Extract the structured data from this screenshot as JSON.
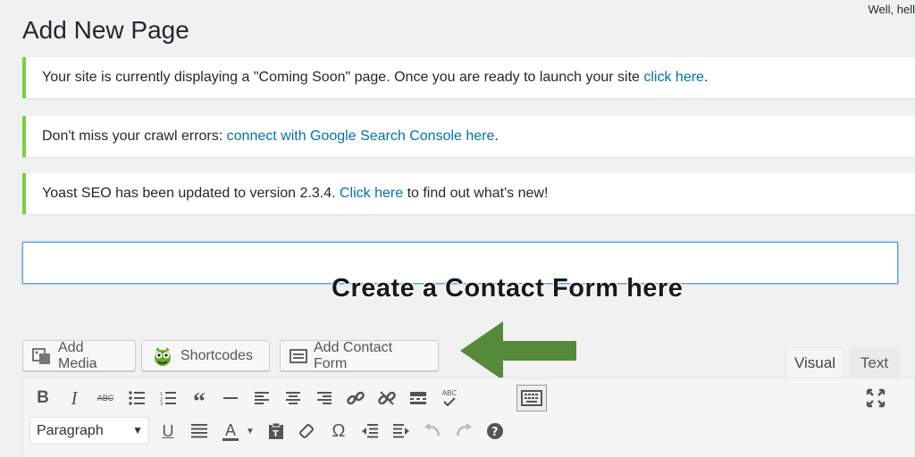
{
  "header": {
    "greeting": "Well, hell",
    "page_title": "Add New Page"
  },
  "notices": [
    {
      "before": "Your site is currently displaying a \"Coming Soon\" page. Once you are ready to launch your site ",
      "link": "click here",
      "after": "."
    },
    {
      "before": "Don't miss your crawl errors: ",
      "link": "connect with Google Search Console here",
      "after": "."
    },
    {
      "before": "Yoast SEO has been updated to version 2.3.4. ",
      "link": "Click here",
      "after": " to find out what's new!"
    }
  ],
  "title_input": {
    "value": "",
    "placeholder": ""
  },
  "annotation": {
    "text": "Create a Contact Form here",
    "arrow_color": "#548a3a"
  },
  "media_buttons": {
    "add_media": "Add Media",
    "shortcodes": "Shortcodes",
    "add_contact_form": "Add Contact Form"
  },
  "editor_tabs": {
    "visual": "Visual",
    "text": "Text"
  },
  "toolbar": {
    "bold": "B",
    "italic": "I",
    "strike": "ABC",
    "format_value": "Paragraph",
    "underline": "U",
    "text_color": "A",
    "omega": "Ω",
    "help": "?",
    "spellcheck": "ABC"
  },
  "colors": {
    "notice_border": "#7ad03a",
    "link": "#0073aa",
    "focus": "#5b9dd9"
  }
}
